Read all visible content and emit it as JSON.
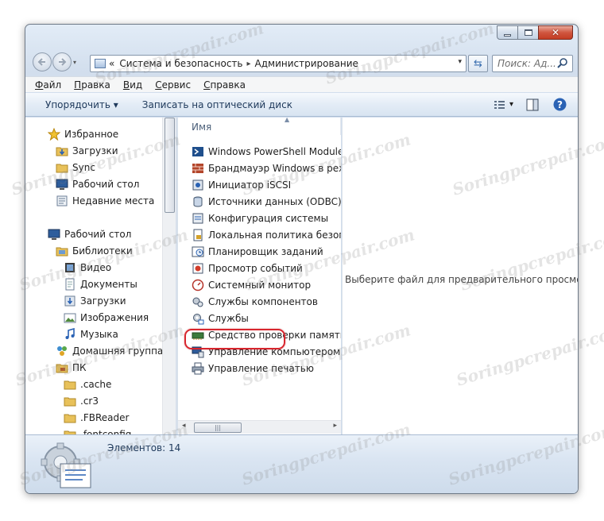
{
  "window": {
    "minimize_icon": "minimize-icon",
    "maximize_icon": "maximize-icon",
    "close_glyph": "✕"
  },
  "address": {
    "overflow_glyph": "«",
    "crumbs": [
      "Система и безопасность",
      "Администрирование"
    ],
    "separator": "▸",
    "dropdown_glyph": "▾",
    "refresh_glyph": "⇆"
  },
  "search": {
    "placeholder": "Поиск: Ад..."
  },
  "menu": {
    "items": [
      {
        "first": "Ф",
        "rest": "айл"
      },
      {
        "first": "П",
        "rest": "равка"
      },
      {
        "first": "В",
        "rest": "ид"
      },
      {
        "first": "С",
        "rest": "ервис"
      },
      {
        "first": "С",
        "rest": "правка"
      }
    ]
  },
  "toolbar": {
    "organize": "Упорядочить ▾",
    "burn": "Записать на оптический диск",
    "view_glyph": "▾"
  },
  "nav": {
    "items": [
      {
        "label": "Избранное",
        "icon": "star-icon"
      },
      {
        "label": "Загрузки",
        "icon": "downloads-icon"
      },
      {
        "label": "Sync",
        "icon": "folder-icon"
      },
      {
        "label": "Рабочий стол",
        "icon": "desktop-icon"
      },
      {
        "label": "Недавние места",
        "icon": "recent-places-icon"
      },
      {
        "label": "Рабочий стол",
        "icon": "desktop-icon"
      },
      {
        "label": "Библиотеки",
        "icon": "libraries-icon"
      },
      {
        "label": "Видео",
        "icon": "video-icon"
      },
      {
        "label": "Документы",
        "icon": "documents-icon"
      },
      {
        "label": "Загрузки",
        "icon": "downloads-icon"
      },
      {
        "label": "Изображения",
        "icon": "pictures-icon"
      },
      {
        "label": "Музыка",
        "icon": "music-icon"
      },
      {
        "label": "Домашняя группа",
        "icon": "homegroup-icon"
      },
      {
        "label": "ПК",
        "icon": "computer-icon"
      },
      {
        "label": ".cache",
        "icon": "folder-icon"
      },
      {
        "label": ".cr3",
        "icon": "folder-icon"
      },
      {
        "label": ".FBReader",
        "icon": "folder-icon"
      },
      {
        "label": ".fontconfig",
        "icon": "folder-icon"
      }
    ]
  },
  "files": {
    "column_name": "Имя",
    "sort_glyph": "▲",
    "items": [
      "Windows PowerShell Modules",
      "Брандмауэр Windows в режиме повышенной безопасности",
      "Инициатор iSCSI",
      "Источники данных (ODBC)",
      "Конфигурация системы",
      "Локальная политика безопасности",
      "Планировщик заданий",
      "Просмотр событий",
      "Системный монитор",
      "Службы компонентов",
      "Службы",
      "Средство проверки памяти Windows",
      "Управление компьютером",
      "Управление печатью"
    ],
    "highlighted_index": 10,
    "hscroll_left": "◂",
    "hscroll_right": "▸",
    "hscroll_grip": "|||"
  },
  "preview": {
    "message": "Выберите файл для предварительного просмотра."
  },
  "details": {
    "count_label": "Элементов: 14"
  },
  "watermark": {
    "text": "Soringpcrepair.com"
  },
  "colors": {
    "highlight_ring": "#d8262e",
    "accent": "#1e395b"
  }
}
